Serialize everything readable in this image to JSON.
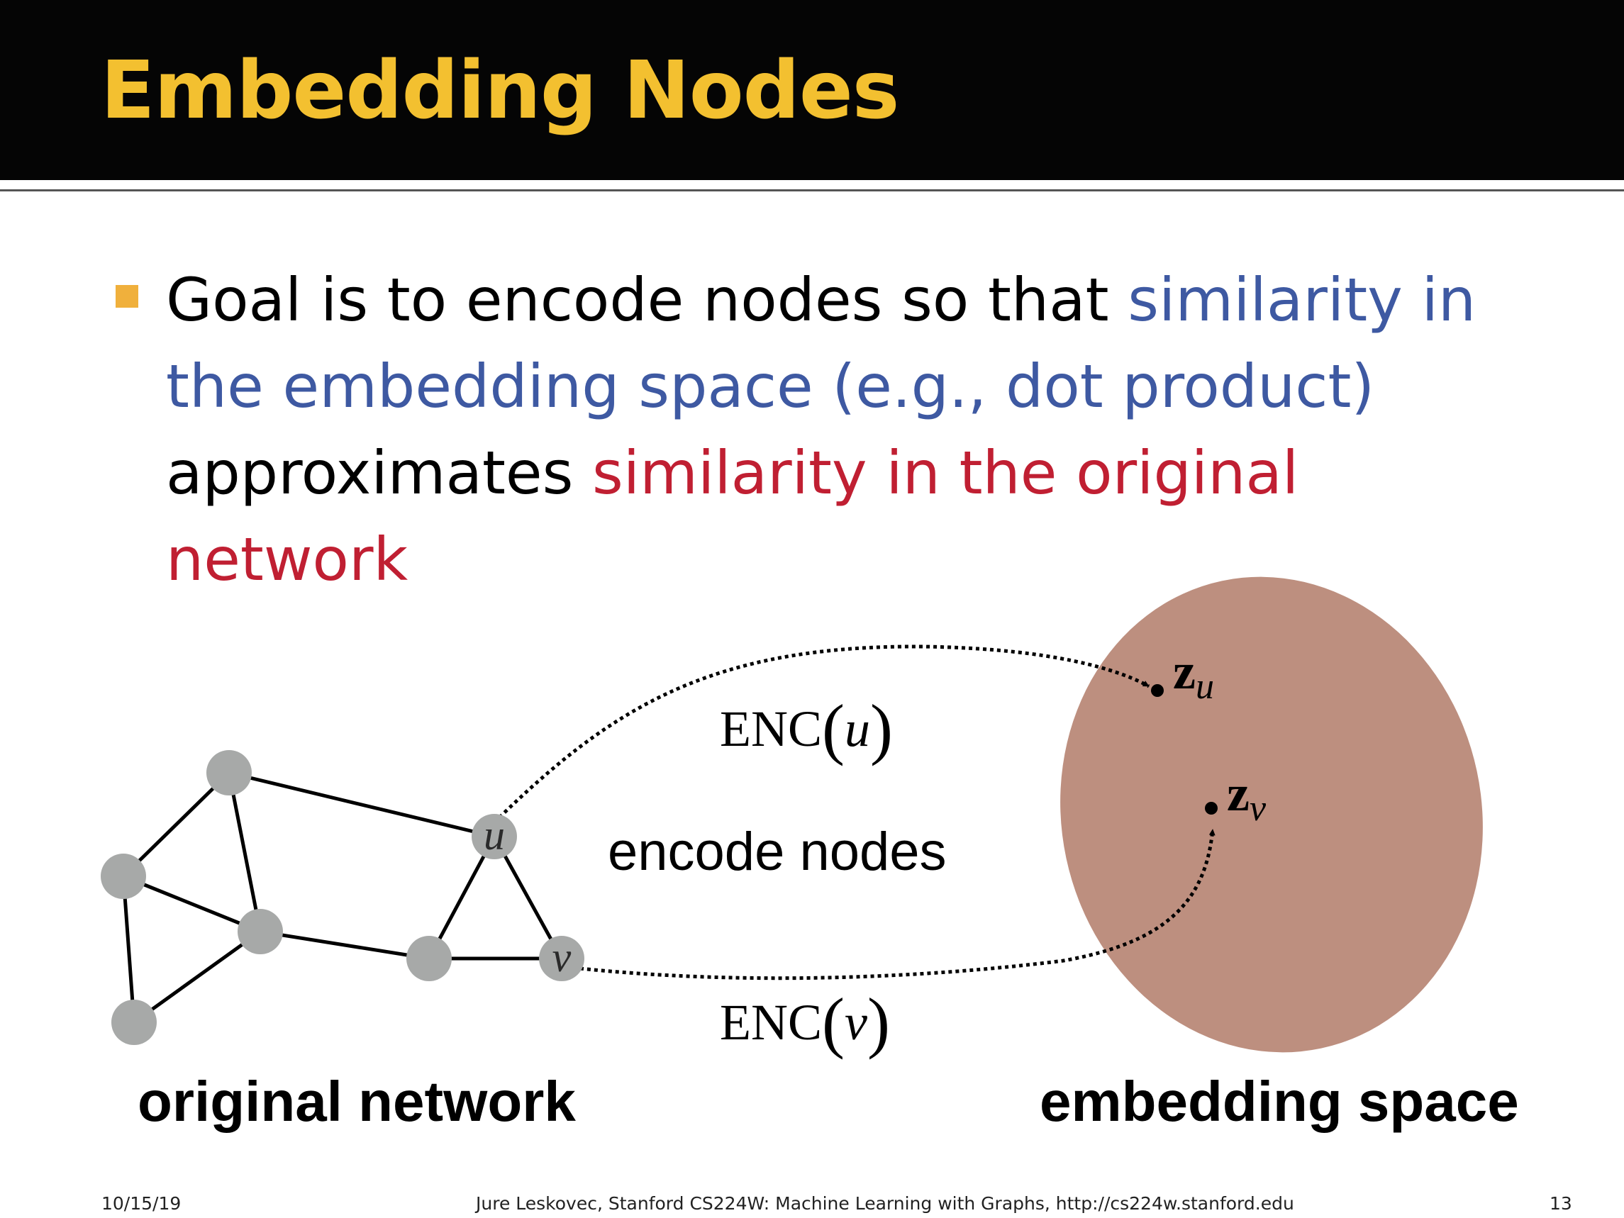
{
  "slide": {
    "title": "Embedding Nodes"
  },
  "bullet": {
    "part1": "Goal is to encode nodes so that ",
    "part2": "similarity in the embedding space (e.g., dot product)",
    "part3": " approximates ",
    "part4": "similarity in the original network"
  },
  "diagram": {
    "node_u": "u",
    "node_v": "v",
    "enc_u": {
      "func": "ENC",
      "arg": "u"
    },
    "enc_v": {
      "func": "ENC",
      "arg": "v"
    },
    "encode_label": "encode nodes",
    "z_u": {
      "base": "z",
      "sub": "u"
    },
    "z_v": {
      "base": "z",
      "sub": "v"
    },
    "original_label": "original network",
    "embedding_label": "embedding space",
    "colors": {
      "node": "#a7a9a8",
      "embedding_space": "#bd8f7f",
      "edge": "#000000"
    }
  },
  "footer": {
    "date": "10/15/19",
    "credit": "Jure Leskovec, Stanford CS224W: Machine Learning with Graphs, http://cs224w.stanford.edu",
    "page": "13"
  },
  "theme": {
    "title_color": "#f3c030",
    "title_bar": "#050505",
    "bullet_marker": "#f0b03c",
    "blue_text": "#3e59a2",
    "red_text": "#c01f32"
  }
}
